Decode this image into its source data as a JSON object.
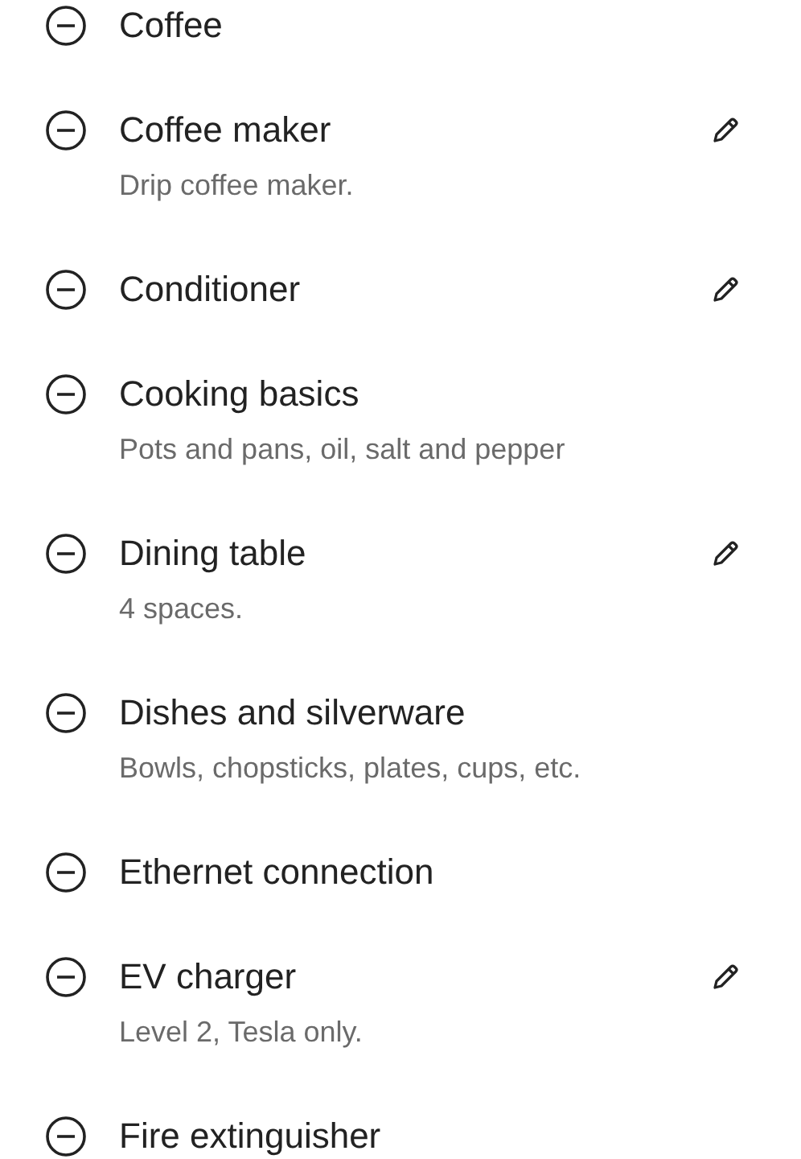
{
  "amenities": [
    {
      "name": "Coffee",
      "editable": false
    },
    {
      "name": "Coffee maker",
      "description": "Drip coffee maker.",
      "editable": true
    },
    {
      "name": "Conditioner",
      "editable": true
    },
    {
      "name": "Cooking basics",
      "description": "Pots and pans, oil, salt and pepper",
      "editable": false
    },
    {
      "name": "Dining table",
      "description": "4 spaces.",
      "editable": true
    },
    {
      "name": "Dishes and silverware",
      "description": "Bowls, chopsticks, plates, cups, etc.",
      "editable": false
    },
    {
      "name": "Ethernet connection",
      "editable": false
    },
    {
      "name": "EV charger",
      "description": "Level 2, Tesla only.",
      "editable": true
    },
    {
      "name": "Fire extinguisher",
      "editable": false
    }
  ]
}
